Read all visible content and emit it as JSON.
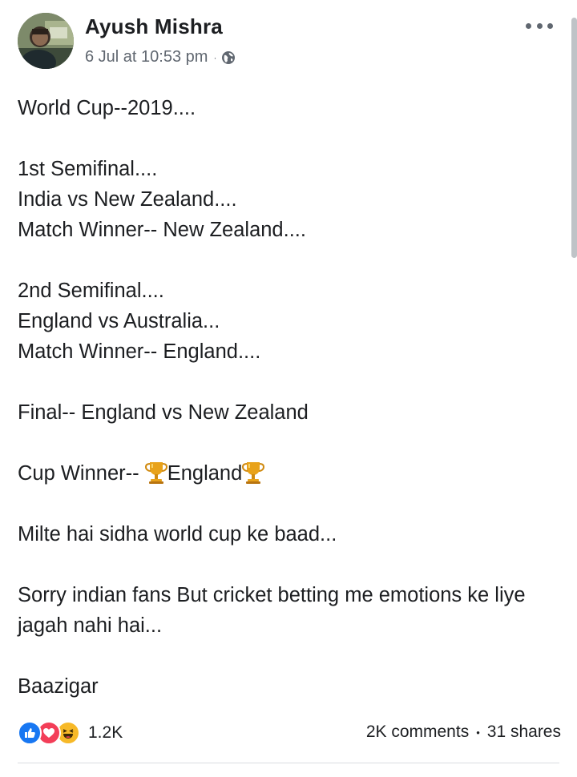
{
  "post": {
    "author": "Ayush Mishra",
    "timestamp": "6 Jul at 10:53 pm",
    "meta_separator": "·",
    "privacy_icon": "globe-icon",
    "menu_icon": "more-horizontal-icon",
    "text": {
      "p1": "World Cup--2019....",
      "p2_l1": "1st Semifinal....",
      "p2_l2": "India vs New Zealand....",
      "p2_l3": "Match Winner-- New Zealand....",
      "p3_l1": "2nd Semifinal....",
      "p3_l2": "England vs Australia...",
      "p3_l3": "Match Winner-- England....",
      "p4": "Final-- England vs New Zealand",
      "p5_prefix": "Cup Winner-- ",
      "p5_team": "England",
      "p6": "Milte hai sidha world cup ke baad...",
      "p7": "Sorry indian fans But cricket betting me emotions ke liye jagah nahi hai...",
      "p8": "Baazigar"
    }
  },
  "footer": {
    "reaction_icons": [
      "like-icon",
      "love-icon",
      "haha-icon"
    ],
    "reaction_count": "1.2K",
    "comments": "2K comments",
    "stats_separator": "•",
    "shares": "31 shares"
  },
  "colors": {
    "text": "#1c1e21",
    "meta": "#606770",
    "like": "#1877f2",
    "love": "#f33e58",
    "haha": "#f7b928",
    "trophy": "#e8a21a"
  }
}
